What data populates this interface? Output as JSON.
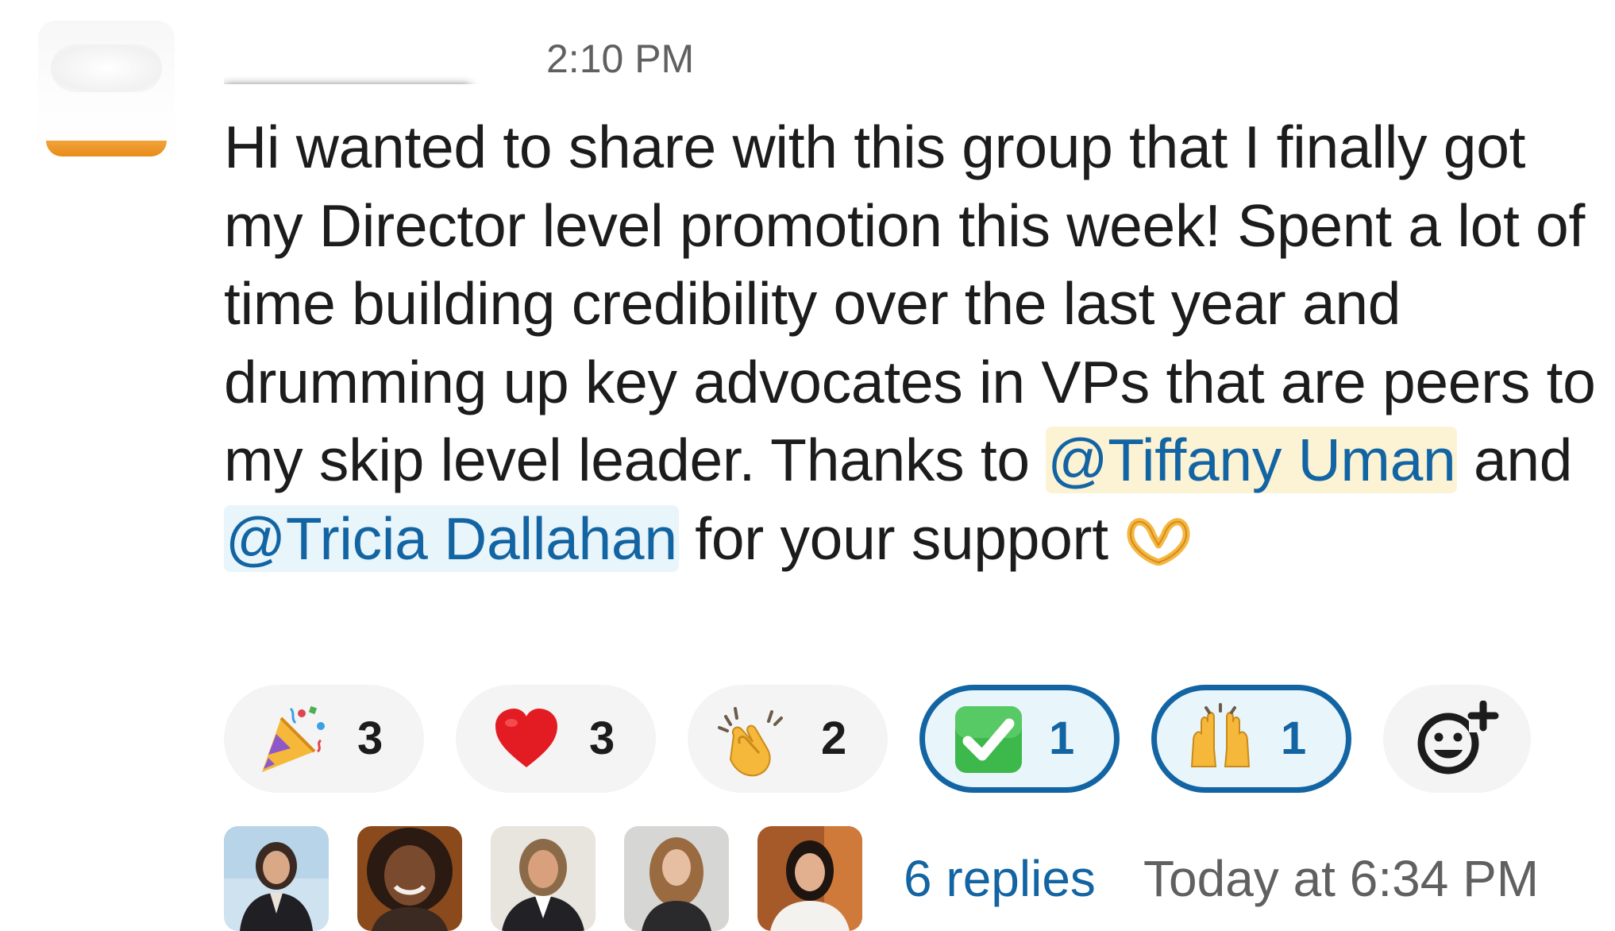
{
  "message": {
    "timestamp": "2:10 PM",
    "text_part1": "Hi wanted to share with this group that I finally got my Director level promotion this week! Spent a lot of time building credibility over the last year and drumming up key advocates in VPs that are peers to my skip level leader. Thanks to ",
    "mention1": "@Tiffany Uman",
    "text_part2": " and ",
    "mention2": "@Tricia Dallahan",
    "text_part3": " for your support ",
    "inline_emoji": "heart-hands"
  },
  "reactions": [
    {
      "emoji": "party-popper",
      "count": "3",
      "active": false
    },
    {
      "emoji": "red-heart",
      "count": "3",
      "active": false
    },
    {
      "emoji": "clapping-hands",
      "count": "2",
      "active": false
    },
    {
      "emoji": "check-mark-button",
      "count": "1",
      "active": true
    },
    {
      "emoji": "raising-hands",
      "count": "1",
      "active": true
    }
  ],
  "add_reaction": {
    "icon": "add-emoji-icon"
  },
  "thread": {
    "replies_label": "6 replies",
    "last_reply": "Today at 6:34 PM"
  },
  "colors": {
    "link": "#1264a3",
    "mention_yellow": "#fcf2d4",
    "mention_blue": "#e8f5fa",
    "pill_bg": "#f4f4f4",
    "text": "#1d1c1d",
    "muted": "#616061"
  }
}
